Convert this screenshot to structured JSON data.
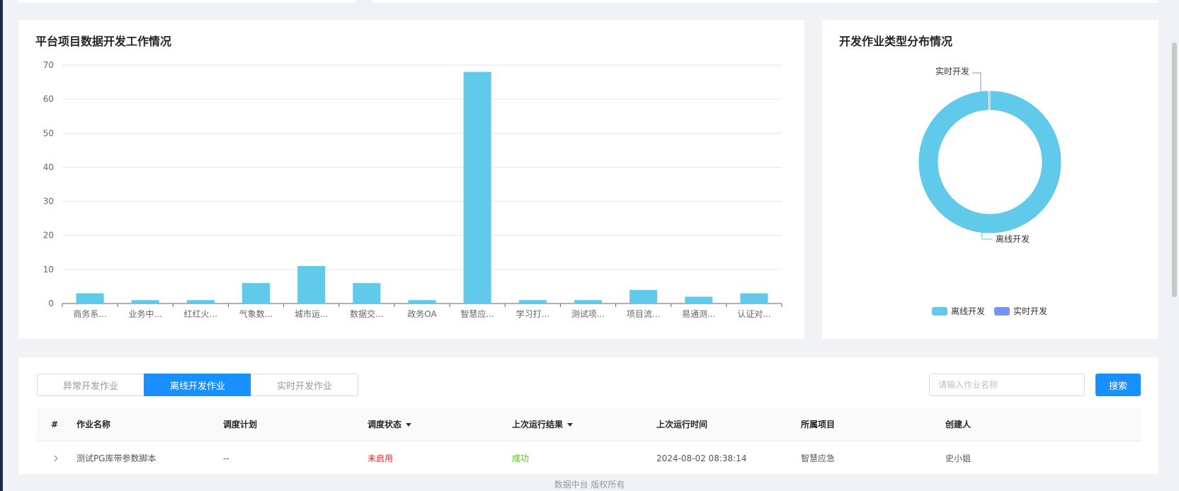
{
  "bar_panel": {
    "title": "平台项目数据开发工作情况",
    "chart_data": {
      "type": "bar",
      "categories": [
        "商务系...",
        "业务中...",
        "红红火...",
        "气象数...",
        "城市运...",
        "数据交...",
        "政务OA",
        "智慧应...",
        "学习打...",
        "测试项...",
        "项目流...",
        "易通测...",
        "认证对..."
      ],
      "values": [
        3,
        1,
        1,
        6,
        11,
        6,
        1,
        68,
        1,
        1,
        4,
        2,
        3
      ],
      "ylim": [
        0,
        70
      ],
      "yticks": [
        "0",
        "10",
        "20",
        "30",
        "40",
        "50",
        "60",
        "70"
      ],
      "grid": true,
      "color": "#61c9e9"
    }
  },
  "pie_panel": {
    "title": "开发作业类型分布情况",
    "chart_data": {
      "type": "pie",
      "style": "donut",
      "slices": [
        {
          "name": "离线开发",
          "value": 99.7,
          "color": "#61c9e9"
        },
        {
          "name": "实时开发",
          "value": 0.3,
          "color": "#7b92f5"
        }
      ],
      "legend": "bottom-center",
      "labels": {
        "offline": "离线开发",
        "realtime": "实时开发"
      }
    }
  },
  "tabs": [
    {
      "label": "异常开发作业",
      "active": false
    },
    {
      "label": "离线开发作业",
      "active": true
    },
    {
      "label": "实时开发作业",
      "active": false
    }
  ],
  "search": {
    "placeholder": "请输入作业名称",
    "button_label": "搜索"
  },
  "table": {
    "headers": {
      "index": "#",
      "name": "作业名称",
      "plan": "调度计划",
      "status": "调度状态",
      "result": "上次运行结果",
      "time": "上次运行时间",
      "project": "所属项目",
      "creator": "创建人"
    },
    "rows": [
      {
        "name": "测试PG库带参数脚本",
        "plan": "--",
        "status": "未启用",
        "result": "成功",
        "time": "2024-08-02 08:38:14",
        "project": "智慧应急",
        "creator": "史小姐"
      }
    ]
  },
  "colors": {
    "primary": "#1890ff",
    "status_disabled": "#f5222d",
    "result_success": "#52c41a"
  },
  "footer": "数据中台 版权所有"
}
